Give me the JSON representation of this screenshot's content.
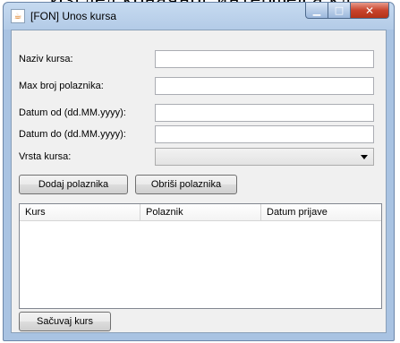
{
  "caption": "Изглед коначног интерфејса кл",
  "window": {
    "title": "[FON] Unos kursa",
    "app_icon": "java-icon",
    "controls": {
      "minimize": "minimize-icon",
      "maximize": "maximize-icon",
      "close": "close-icon"
    }
  },
  "form": {
    "naziv_label": "Naziv kursa:",
    "naziv_value": "",
    "max_label": "Max broj polaznika:",
    "max_value": "",
    "od_label": "Datum od (dd.MM.yyyy):",
    "od_value": "",
    "do_label": "Datum do (dd.MM.yyyy):",
    "do_value": "",
    "vrsta_label": "Vrsta kursa:",
    "vrsta_value": ""
  },
  "buttons": {
    "dodaj": "Dodaj polaznika",
    "obrisi": "Obriši polaznika",
    "sacuvaj": "Sačuvaj kurs"
  },
  "table": {
    "columns": [
      "Kurs",
      "Polaznik",
      "Datum prijave"
    ],
    "rows": []
  }
}
